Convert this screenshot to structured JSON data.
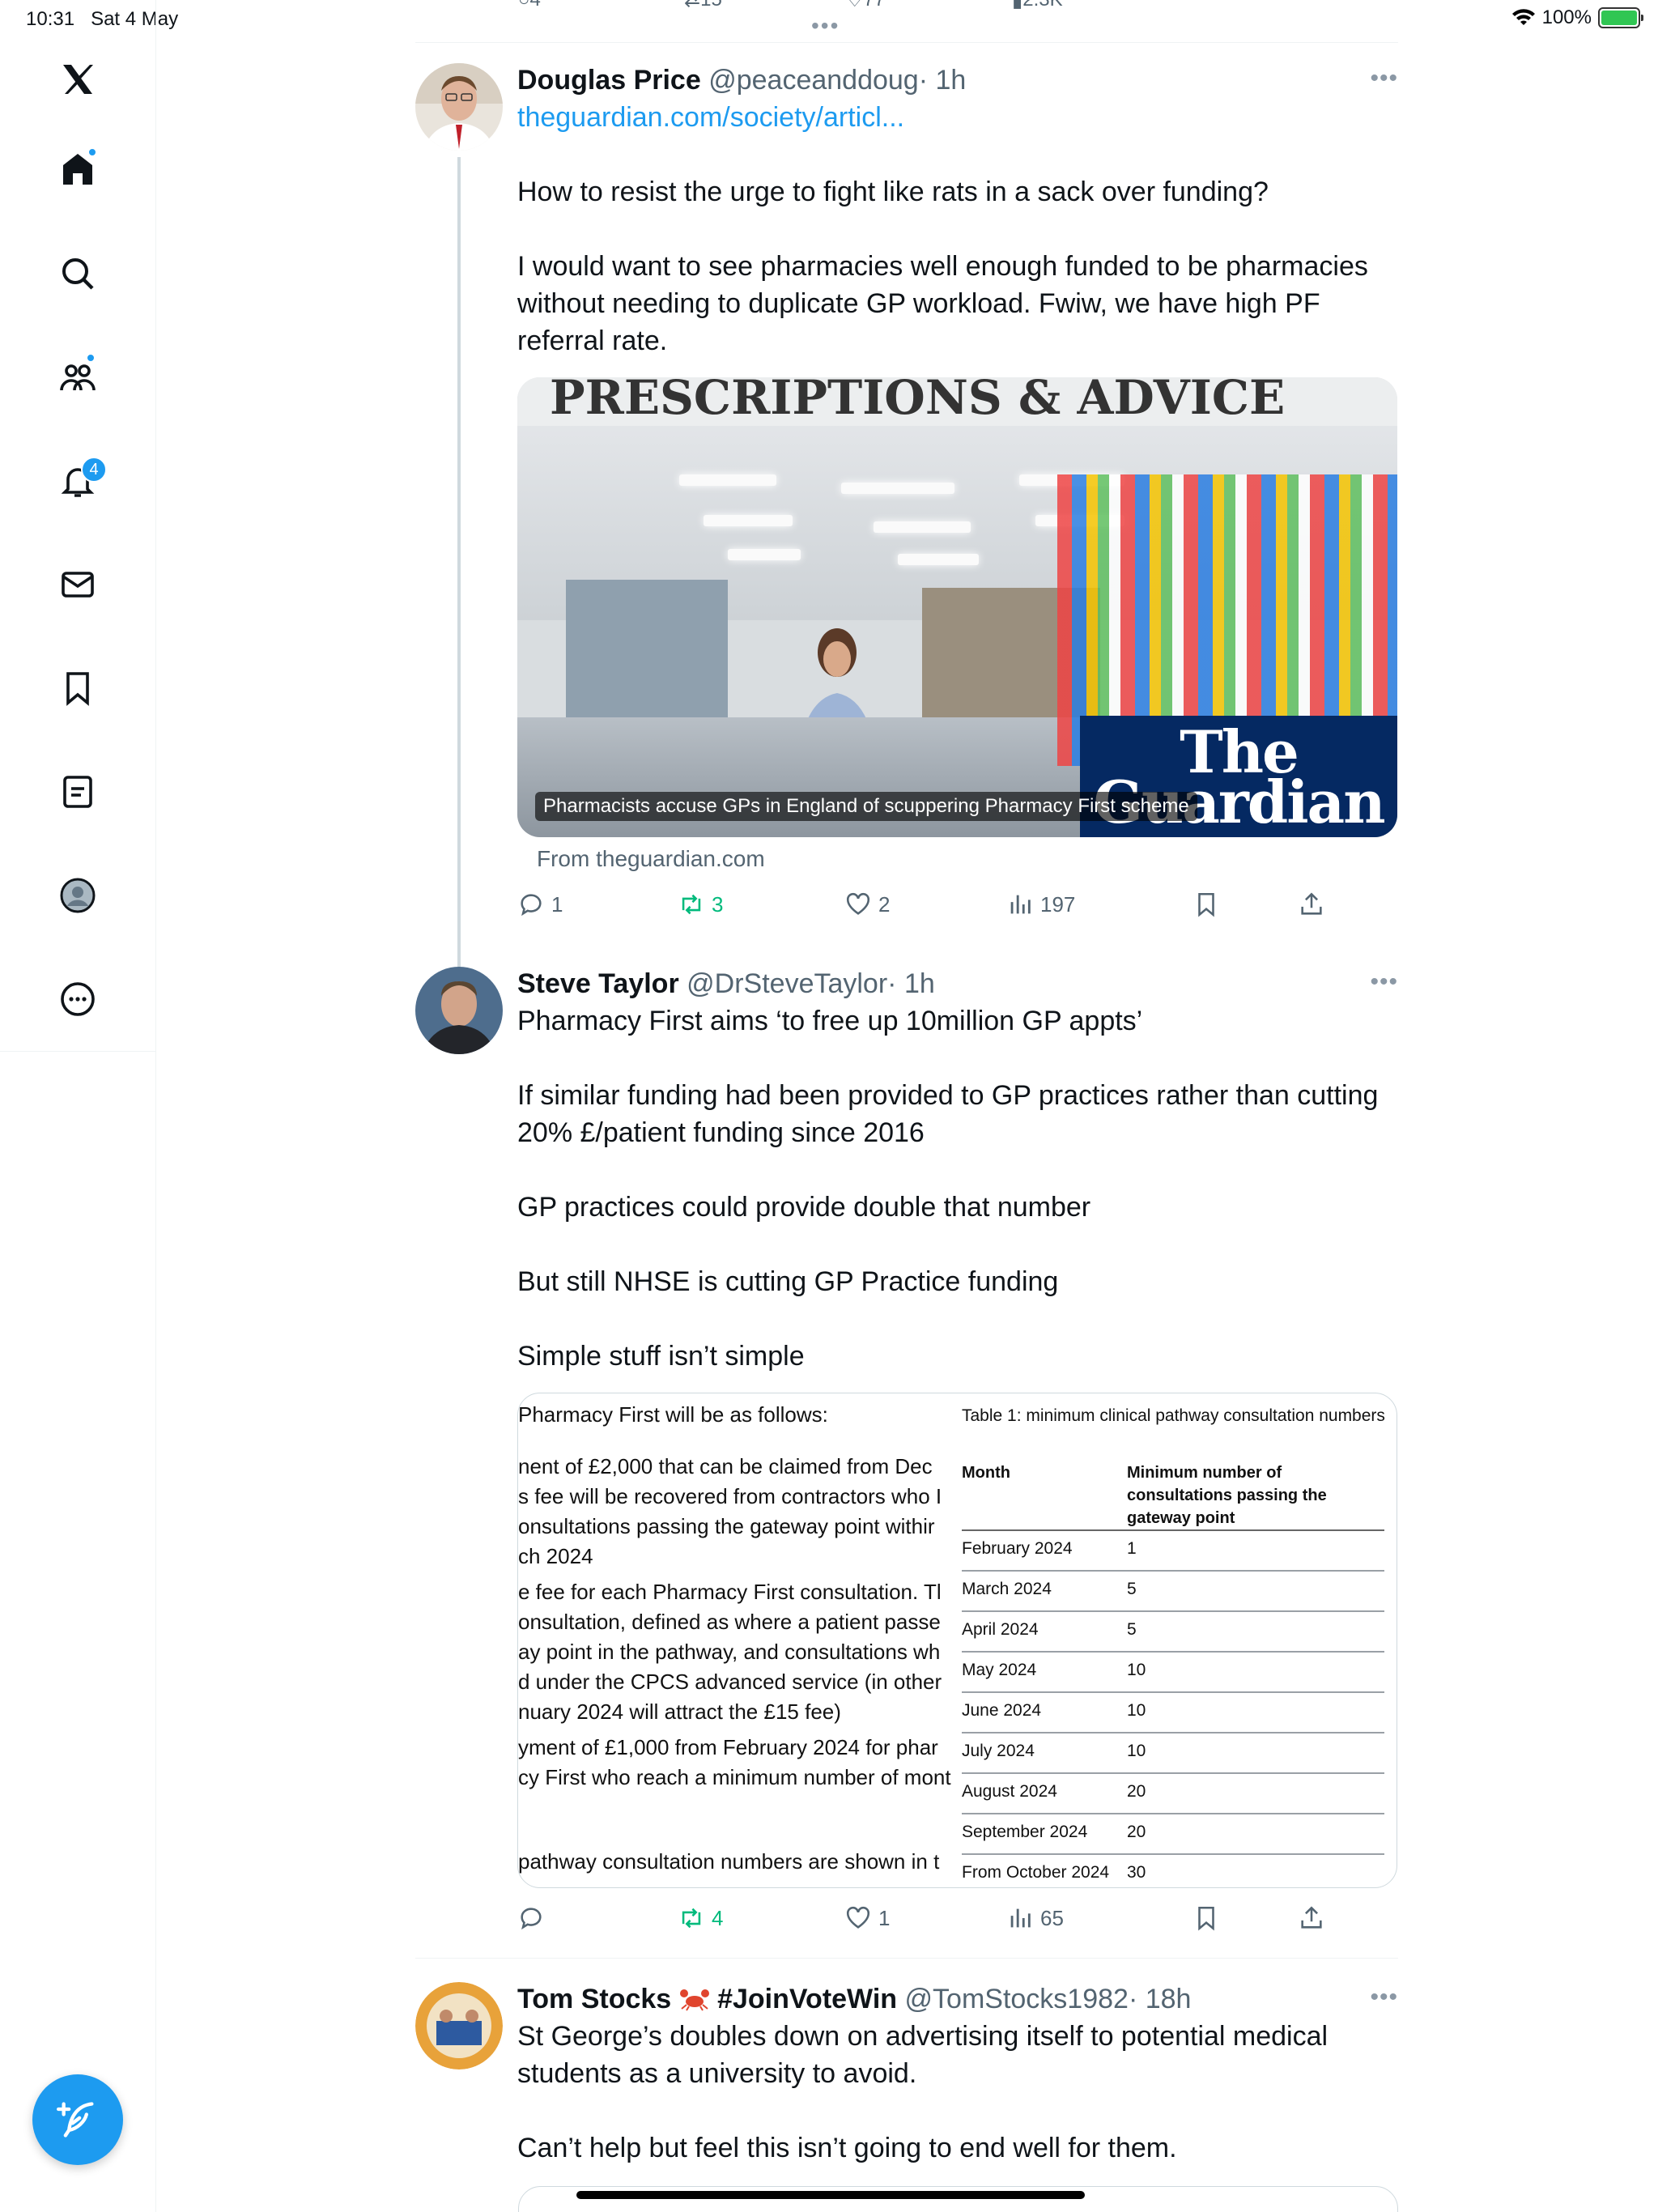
{
  "status_bar": {
    "time": "10:31",
    "date": "Sat 4 May",
    "battery": "100%"
  },
  "sidebar": {
    "items": [
      "home",
      "explore",
      "communities",
      "notifications",
      "messages",
      "bookmarks",
      "lists",
      "profile",
      "more"
    ],
    "notification_count": "4"
  },
  "top_tweet_actions": {
    "replies": "4",
    "reposts": "15",
    "likes": "77",
    "views": "2.3K"
  },
  "tweets": [
    {
      "name": "Douglas Price",
      "handle": "@peaceanddoug",
      "time": "· 1h",
      "link": "theguardian.com/society/articl...",
      "body": [
        "How to resist the urge to fight like rats in a sack over funding?",
        "I would want to see pharmacies well enough funded to be pharmacies without needing to duplicate GP workload. Fwiw, we have high PF referral rate."
      ],
      "card": {
        "signboard": "PRESCRIPTIONS & ADVICE",
        "caption": "Pharmacists accuse GPs in England of scuppering Pharmacy First scheme",
        "logo_line1": "The",
        "logo_line2": "Guardian",
        "source": "From theguardian.com"
      },
      "actions": {
        "replies": "1",
        "reposts": "3",
        "likes": "2",
        "views": "197"
      }
    },
    {
      "name": "Steve Taylor",
      "handle": "@DrSteveTaylor",
      "time": "· 1h",
      "body": [
        "Pharmacy First aims ‘to free up 10million GP appts’",
        "If similar funding had been provided to GP practices rather than cutting 20% £/patient funding since 2016",
        "GP practices could provide double that number",
        "But still NHSE is cutting GP Practice funding",
        "Simple stuff isn’t simple"
      ],
      "doc": {
        "left_lines": [
          "Pharmacy First will be as follows:",
          "nent of £2,000 that can be claimed from Dec",
          "s fee will be recovered from contractors who I",
          "onsultations passing the gateway point withir",
          "ch 2024",
          "e fee for each Pharmacy First consultation. Tl",
          "onsultation, defined as where a patient passe",
          "ay point in the pathway, and consultations wh",
          "d under the CPCS advanced service (in other",
          "nuary 2024 will attract the £15 fee)",
          "yment of £1,000 from February 2024 for phar",
          "cy First who reach a minimum number of mont",
          "pathway consultation numbers are shown in t"
        ],
        "table_title": "Table 1: minimum clinical pathway consultation numbers",
        "col_month": "Month",
        "col_min": "Minimum number of consultations passing the gateway point",
        "rows": [
          {
            "month": "February 2024",
            "value": "1"
          },
          {
            "month": "March 2024",
            "value": "5"
          },
          {
            "month": "April 2024",
            "value": "5"
          },
          {
            "month": "May 2024",
            "value": "10"
          },
          {
            "month": "June 2024",
            "value": "10"
          },
          {
            "month": "July 2024",
            "value": "10"
          },
          {
            "month": "August 2024",
            "value": "20"
          },
          {
            "month": "September 2024",
            "value": "20"
          },
          {
            "month": "From October 2024",
            "value": "30"
          }
        ]
      },
      "actions": {
        "replies": "",
        "reposts": "4",
        "likes": "1",
        "views": "65"
      }
    },
    {
      "name_part1": "Tom Stocks",
      "name_part2": "#JoinVoteWin",
      "handle": "@TomStocks1982",
      "time": "· 18h",
      "body": [
        "St George’s doubles down on advertising itself to potential medical students as a university to avoid.",
        "Can’t help but feel this isn’t going to end well for them."
      ]
    }
  ],
  "colors": {
    "accent": "#1d9bf0",
    "repost_green": "#00ba7c",
    "muted": "#536471",
    "guardian_blue": "#052962"
  }
}
